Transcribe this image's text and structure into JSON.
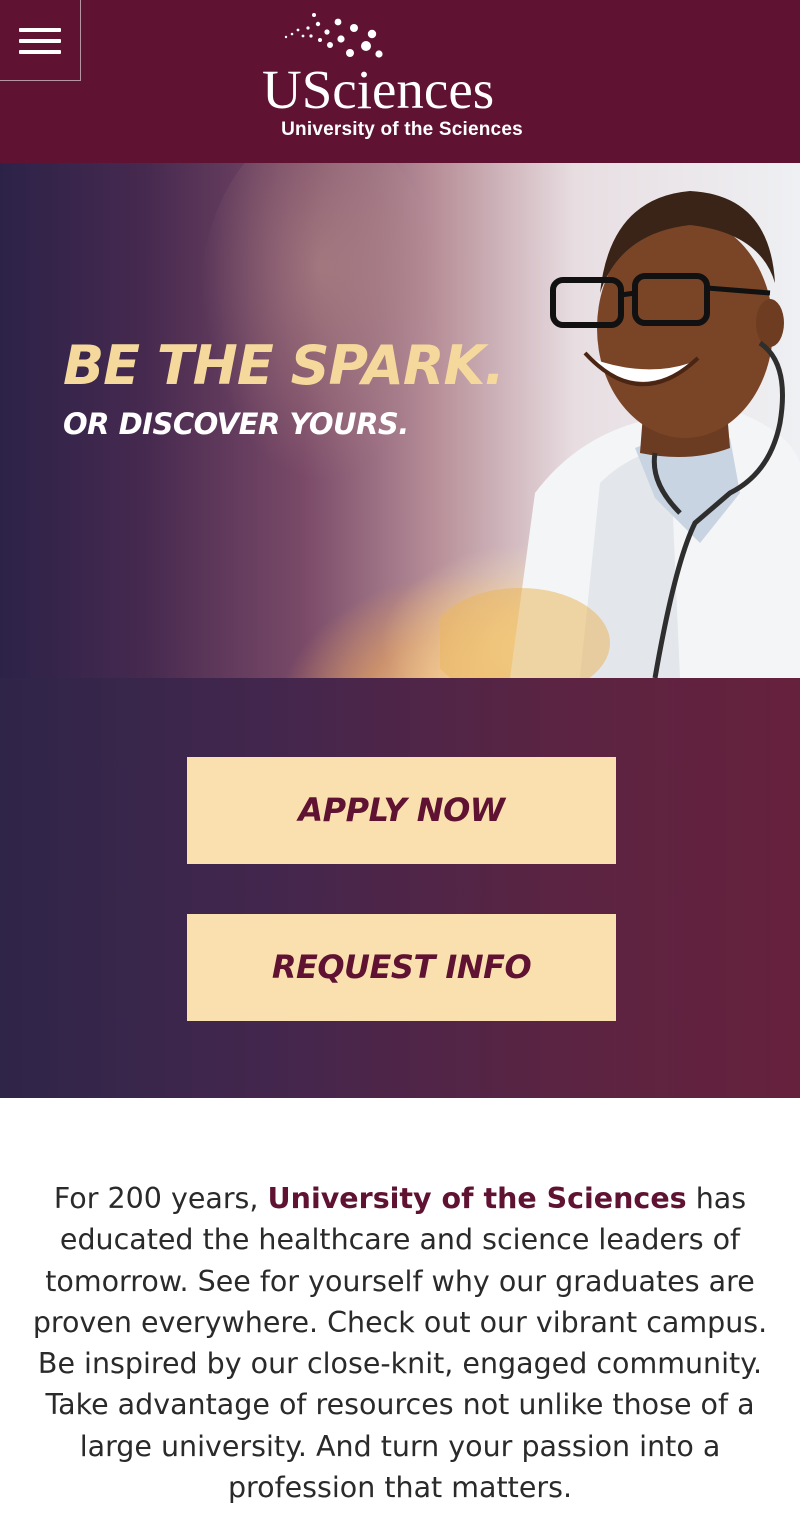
{
  "header": {
    "menu_icon": "hamburger-menu-icon",
    "logo": {
      "wordmark": "USciences",
      "subtitle": "University of the Sciences"
    },
    "background_color": "#5f1232"
  },
  "hero": {
    "headline": "BE THE SPARK.",
    "subhead": "OR DISCOVER YOURS.",
    "headline_color": "#f5d99c"
  },
  "cta": {
    "apply_label": "APPLY NOW",
    "request_label": "REQUEST INFO",
    "button_color": "#fae0ae",
    "text_color": "#5f1232"
  },
  "intro": {
    "lead": "For 200 years,",
    "university_name": "University of the Sciences",
    "body": "has educated the healthcare and science leaders of tomorrow. See for yourself why our graduates are proven everywhere. Check out our vibrant campus. Be inspired by our close-knit, engaged community. Take advantage of resources not unlike those of a large university. And turn your passion into a profession that matters."
  }
}
